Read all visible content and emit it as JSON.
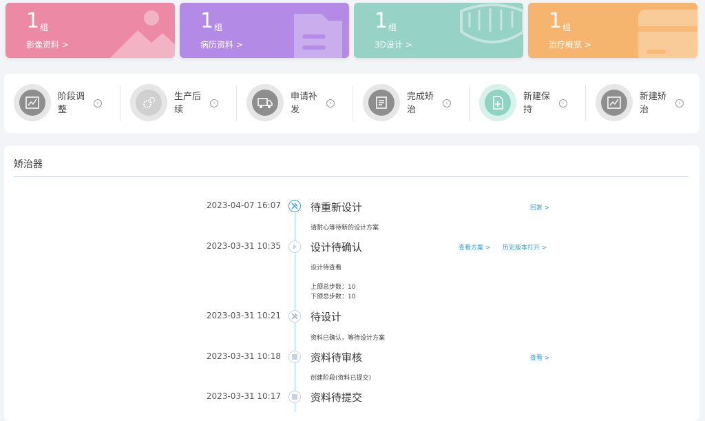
{
  "stats": [
    {
      "num": "1",
      "unit": "组",
      "label": "影像资料 >",
      "color": "#ec8aa6",
      "icon": "image-icon"
    },
    {
      "num": "1",
      "unit": "组",
      "label": "病历资料 >",
      "color": "#b38ae6",
      "icon": "folder-icon"
    },
    {
      "num": "1",
      "unit": "组",
      "label": "3D设计 >",
      "color": "#96d2c5",
      "icon": "teeth-icon"
    },
    {
      "num": "1",
      "unit": "组",
      "label": "治疗概览 >",
      "color": "#f6b56e",
      "icon": "card-icon"
    }
  ],
  "actions": [
    {
      "label": "阶段调整",
      "icon": "chart-icon"
    },
    {
      "label": "生产后续",
      "icon": "gear-icon"
    },
    {
      "label": "申请补发",
      "icon": "truck-icon"
    },
    {
      "label": "完成矫治",
      "icon": "document-icon"
    },
    {
      "label": "新建保持",
      "icon": "add-file-icon"
    },
    {
      "label": "新建矫治",
      "icon": "chart-icon"
    }
  ],
  "panel": {
    "title": "矫治器"
  },
  "timeline": [
    {
      "date": "2023-04-07 16:07",
      "title": "待重新设计",
      "icon": "tools-icon",
      "desc": [
        "请耐心等待新的设计方案"
      ],
      "links": [
        "回复 >"
      ]
    },
    {
      "date": "2023-03-31 10:35",
      "title": "设计待确认",
      "icon": "play-icon",
      "desc": [
        "设计待查看",
        "上颌总步数：10",
        "下颌总步数：10"
      ],
      "links": [
        "查看方案 >",
        "历史版本打开 >"
      ]
    },
    {
      "date": "2023-03-31 10:21",
      "title": "待设计",
      "icon": "tools-icon",
      "desc": [
        "资料已确认，等待设计方案"
      ],
      "links": []
    },
    {
      "date": "2023-03-31 10:18",
      "title": "资料待审核",
      "icon": "square-icon",
      "desc": [
        "创建阶段(资料已提交)"
      ],
      "links": [
        "查看 >"
      ]
    },
    {
      "date": "2023-03-31 10:17",
      "title": "资料待提交",
      "icon": "square-icon",
      "desc": [],
      "links": []
    }
  ]
}
